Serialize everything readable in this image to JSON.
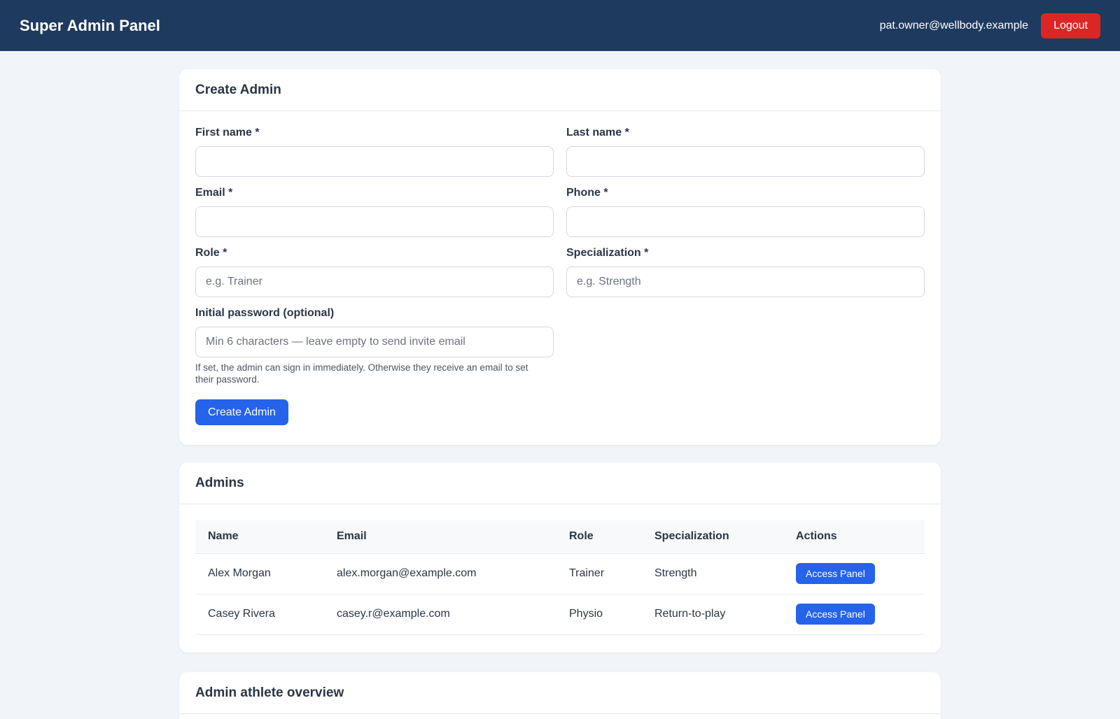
{
  "header": {
    "title": "Super Admin Panel",
    "user_email": "pat.owner@wellbody.example",
    "logout_label": "Logout"
  },
  "create_admin": {
    "title": "Create Admin",
    "fields": {
      "first_name": {
        "label": "First name *",
        "value": "",
        "placeholder": ""
      },
      "last_name": {
        "label": "Last name *",
        "value": "",
        "placeholder": ""
      },
      "email": {
        "label": "Email *",
        "value": "",
        "placeholder": ""
      },
      "phone": {
        "label": "Phone *",
        "value": "",
        "placeholder": ""
      },
      "role": {
        "label": "Role *",
        "value": "",
        "placeholder": "e.g. Trainer"
      },
      "specialization": {
        "label": "Specialization *",
        "value": "",
        "placeholder": "e.g. Strength"
      },
      "password": {
        "label": "Initial password (optional)",
        "value": "",
        "placeholder": "Min 6 characters — leave empty to send invite email"
      }
    },
    "password_hint": "If set, the admin can sign in immediately. Otherwise they receive an email to set their password.",
    "submit_label": "Create Admin"
  },
  "admins": {
    "title": "Admins",
    "columns": [
      "Name",
      "Email",
      "Role",
      "Specialization",
      "Actions"
    ],
    "rows": [
      {
        "name": "Alex Morgan",
        "email": "alex.morgan@example.com",
        "role": "Trainer",
        "specialization": "Strength",
        "action_label": "Access Panel"
      },
      {
        "name": "Casey Rivera",
        "email": "casey.r@example.com",
        "role": "Physio",
        "specialization": "Return-to-play",
        "action_label": "Access Panel"
      }
    ]
  },
  "overview": {
    "title": "Admin athlete overview"
  },
  "colors": {
    "header_bg": "#1e3a5f",
    "logout": "#dc2626",
    "primary": "#2563eb",
    "page_bg": "#f1f4f8"
  }
}
